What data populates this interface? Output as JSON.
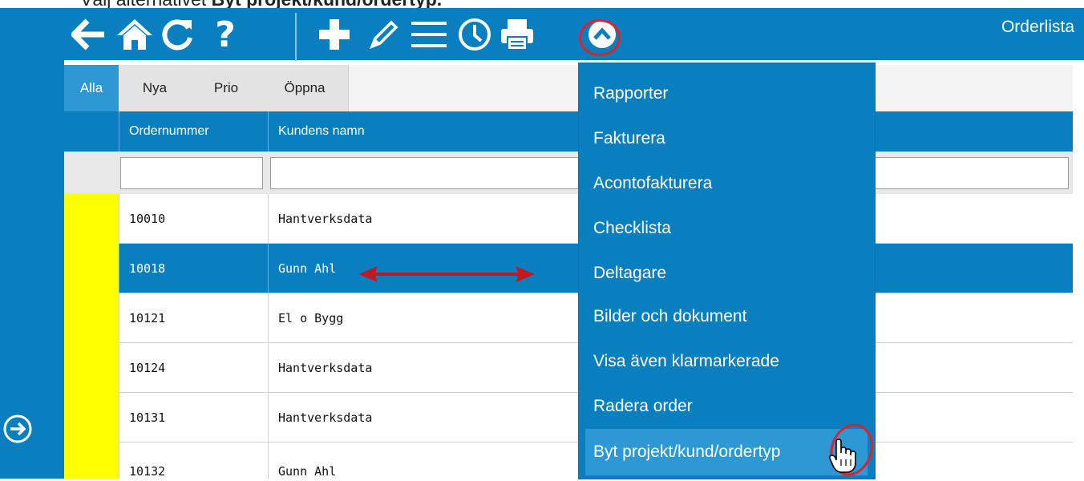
{
  "caption": {
    "prefix": "Välj alternativet ",
    "bold": "Byt projekt/kund/ordertyp."
  },
  "toolbar": {
    "icons": [
      "back-arrow-icon",
      "home-icon",
      "refresh-icon",
      "help-icon",
      "add-icon",
      "edit-pencil-icon",
      "menu-lines-icon",
      "clock-icon",
      "print-icon",
      "chevron-up-icon"
    ],
    "help_glyph": "?",
    "title": "Orderlista"
  },
  "tabs": [
    "Alla",
    "Nya",
    "Prio",
    "Öppna"
  ],
  "grid": {
    "columns": [
      "Ordernummer",
      "Kundens namn"
    ],
    "rows": [
      {
        "order": "10010",
        "customer": "Hantverksdata",
        "selected": false
      },
      {
        "order": "10018",
        "customer": "Gunn Ahl",
        "selected": true
      },
      {
        "order": "10121",
        "customer": "El o Bygg",
        "selected": false
      },
      {
        "order": "10124",
        "customer": "Hantverksdata",
        "selected": false
      },
      {
        "order": "10131",
        "customer": "Hantverksdata",
        "selected": false
      },
      {
        "order": "10132",
        "customer": "Gunn Ahl",
        "selected": false
      }
    ]
  },
  "menu": {
    "items": [
      "Rapporter",
      "Fakturera",
      "Acontofakturera",
      "Checklista",
      "Deltagare",
      "Bilder och dokument",
      "Visa även klarmarkerade",
      "Radera order",
      "Byt projekt/kund/ordertyp"
    ],
    "highlighted": "Byt projekt/kund/ordertyp"
  },
  "colors": {
    "primary": "#0a7fc0",
    "highlight": "#2c99d5",
    "marker": "#ffff00",
    "annotation": "#d9242b"
  }
}
